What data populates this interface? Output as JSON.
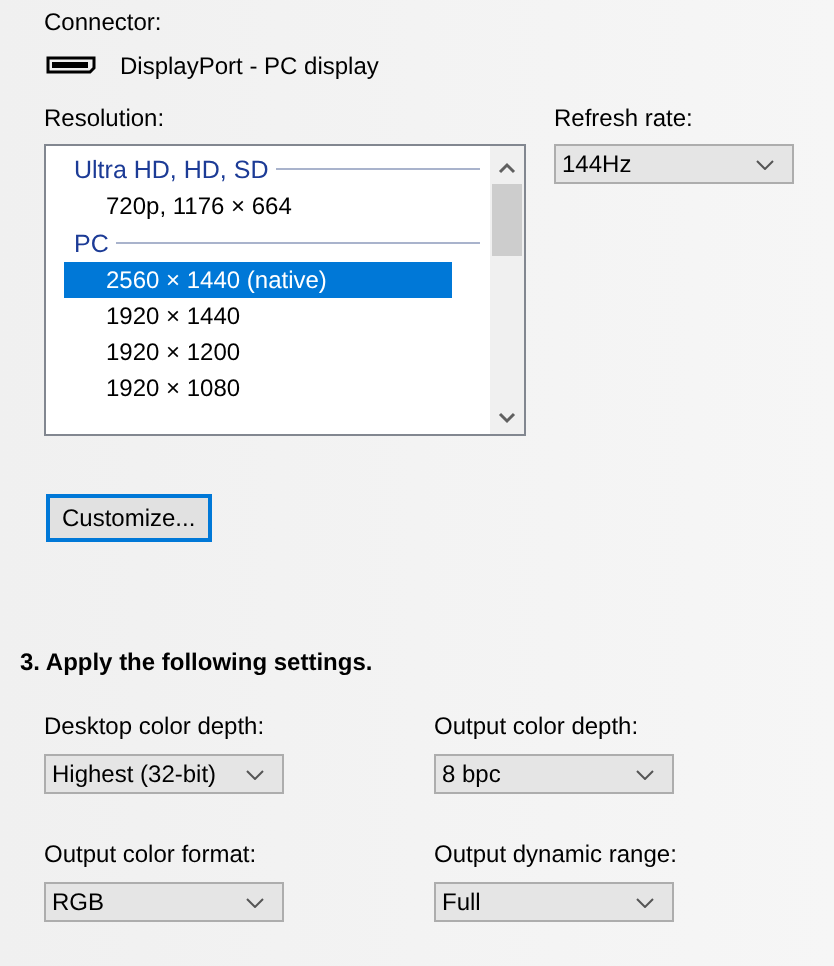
{
  "connector": {
    "label": "Connector:",
    "value": "DisplayPort - PC display"
  },
  "resolution": {
    "label": "Resolution:",
    "groups": [
      {
        "header": "Ultra HD, HD, SD",
        "items": [
          {
            "text": "720p, 1176 × 664",
            "selected": false
          }
        ]
      },
      {
        "header": "PC",
        "items": [
          {
            "text": "2560 × 1440 (native)",
            "selected": true
          },
          {
            "text": "1920 × 1440",
            "selected": false
          },
          {
            "text": "1920 × 1200",
            "selected": false
          },
          {
            "text": "1920 × 1080",
            "selected": false
          }
        ]
      }
    ]
  },
  "refresh_rate": {
    "label": "Refresh rate:",
    "value": "144Hz"
  },
  "customize_button": "Customize...",
  "section_title": "3. Apply the following settings.",
  "settings": [
    {
      "label": "Desktop color depth:",
      "value": "Highest (32-bit)"
    },
    {
      "label": "Output color depth:",
      "value": "8 bpc"
    },
    {
      "label": "Output color format:",
      "value": "RGB"
    },
    {
      "label": "Output dynamic range:",
      "value": "Full"
    }
  ]
}
